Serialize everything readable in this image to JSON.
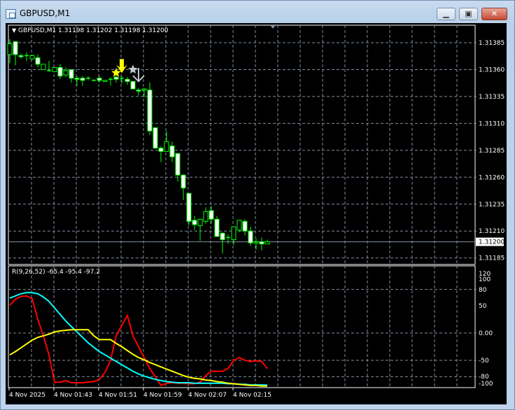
{
  "window": {
    "title": "GBPUSD,M1",
    "minimize_icon": "minimize-icon",
    "maximize_icon": "restore-icon",
    "close_icon": "close-icon"
  },
  "chart": {
    "header": "GBPUSD,M1  1.31198 1.31202 1.31198 1.31200",
    "symbol": "GBPUSD,M1",
    "current_price": "1.31200",
    "price_ticks": [
      "1.31385",
      "1.31360",
      "1.31335",
      "1.31310",
      "1.31285",
      "1.31260",
      "1.31235",
      "1.31210",
      "1.31185"
    ],
    "time_labels": [
      "4 Nov 2025",
      "4 Nov 01:43",
      "4 Nov 01:51",
      "4 Nov 01:59",
      "4 Nov 02:07",
      "4 Nov 02:15"
    ],
    "colors": {
      "background": "#000000",
      "bull": "#00ff00",
      "bear_fill": "#ffffff",
      "grid": "#8090a0",
      "bid_line": "#8090a0"
    },
    "candles_ohlc": [
      [
        1.31374,
        1.31388,
        1.31366,
        1.31384
      ],
      [
        1.31386,
        1.31386,
        1.31364,
        1.31374
      ],
      [
        1.31373,
        1.31375,
        1.3137,
        1.31372
      ],
      [
        1.31373,
        1.31376,
        1.31368,
        1.31373
      ],
      [
        1.3137,
        1.31374,
        1.31369,
        1.31373
      ],
      [
        1.31371,
        1.31374,
        1.31362,
        1.31365
      ],
      [
        1.3136,
        1.31365,
        1.3136,
        1.31365
      ],
      [
        1.31359,
        1.31368,
        1.31358,
        1.31359
      ],
      [
        1.31358,
        1.31362,
        1.31358,
        1.31362
      ],
      [
        1.31362,
        1.31365,
        1.31351,
        1.31354
      ],
      [
        1.31355,
        1.31362,
        1.31353,
        1.31359
      ],
      [
        1.3136,
        1.3136,
        1.31348,
        1.31352
      ],
      [
        1.31352,
        1.31354,
        1.31345,
        1.31351
      ],
      [
        1.31352,
        1.31354,
        1.31345,
        1.3135
      ],
      [
        1.31352,
        1.31354,
        1.3135,
        1.31352
      ],
      [
        1.3135,
        1.31351,
        1.31349,
        1.3135
      ],
      [
        1.31352,
        1.31354,
        1.31348,
        1.3135
      ],
      [
        1.31349,
        1.3135,
        1.31349,
        1.3135
      ],
      [
        1.31351,
        1.31353,
        1.31345,
        1.31351
      ],
      [
        1.31353,
        1.31354,
        1.31348,
        1.31351
      ],
      [
        1.31352,
        1.31354,
        1.31347,
        1.31352
      ],
      [
        1.31351,
        1.31353,
        1.31346,
        1.31349
      ],
      [
        1.31349,
        1.31349,
        1.31342,
        1.31342
      ],
      [
        1.31341,
        1.31343,
        1.31336,
        1.3134
      ],
      [
        1.31341,
        1.31343,
        1.31334,
        1.31342
      ],
      [
        1.31341,
        1.31348,
        1.31299,
        1.31303
      ],
      [
        1.31306,
        1.31306,
        1.31287,
        1.31287
      ],
      [
        1.31287,
        1.31289,
        1.31274,
        1.31284
      ],
      [
        1.31284,
        1.31303,
        1.31284,
        1.31293
      ],
      [
        1.31289,
        1.31293,
        1.31274,
        1.31279
      ],
      [
        1.31282,
        1.31282,
        1.31256,
        1.31262
      ],
      [
        1.31262,
        1.31263,
        1.31239,
        1.3125
      ],
      [
        1.31245,
        1.31245,
        1.31215,
        1.31219
      ],
      [
        1.3122,
        1.31224,
        1.31211,
        1.31216
      ],
      [
        1.31215,
        1.31221,
        1.31201,
        1.31221
      ],
      [
        1.31219,
        1.31232,
        1.31217,
        1.31228
      ],
      [
        1.31229,
        1.31233,
        1.31217,
        1.31221
      ],
      [
        1.31221,
        1.31224,
        1.31205,
        1.31205
      ],
      [
        1.31208,
        1.31209,
        1.31189,
        1.31202
      ],
      [
        1.31204,
        1.31207,
        1.31198,
        1.31204
      ],
      [
        1.31202,
        1.31214,
        1.31197,
        1.31214
      ],
      [
        1.31211,
        1.3122,
        1.31209,
        1.3122
      ],
      [
        1.31219,
        1.31221,
        1.31206,
        1.3121
      ],
      [
        1.3121,
        1.31214,
        1.31196,
        1.31199
      ],
      [
        1.31199,
        1.31203,
        1.31193,
        1.312
      ],
      [
        1.312,
        1.31204,
        1.31192,
        1.31198
      ],
      [
        1.31198,
        1.31202,
        1.31198,
        1.312
      ]
    ],
    "markers": [
      {
        "type": "star",
        "candle": 19,
        "price": 1.31357,
        "color": "#ffff00"
      },
      {
        "type": "arrow-down",
        "candle": 20,
        "price": 1.31362,
        "color": "#ffff00"
      },
      {
        "type": "star",
        "candle": 22,
        "price": 1.3136,
        "color": "#c0c8d0"
      },
      {
        "type": "arrow-down-outline",
        "candle": 23,
        "price": 1.31355,
        "color": "#c0c8d0"
      }
    ]
  },
  "indicator": {
    "label": "R(9,26,52) -65.4 -95.4 -97.2",
    "ticks": [
      "120",
      "100",
      "80",
      "50",
      "0.00",
      "-50",
      "-80",
      "-100"
    ],
    "tick_values": [
      120,
      100,
      80,
      50,
      0,
      -50,
      -80,
      -100
    ],
    "grid_levels": [
      80,
      0,
      -50,
      -80
    ],
    "series": [
      {
        "color": "#ff0000",
        "values": [
          51,
          62,
          67,
          68,
          63,
          25,
          -5,
          -40,
          -90,
          -90,
          -87,
          -91,
          -91,
          -91,
          -90,
          -89,
          -85,
          -72,
          -50,
          -5,
          14,
          32,
          -5,
          -25,
          -45,
          -65,
          -80,
          -96,
          -92,
          -91,
          -92,
          -92,
          -93,
          -93,
          -90,
          -78,
          -70,
          -70,
          -70,
          -65,
          -50,
          -45,
          -50,
          -52,
          -51,
          -52,
          -65.4
        ]
      },
      {
        "color": "#00ffff",
        "values": [
          64,
          68,
          72,
          74,
          74,
          72,
          66,
          58,
          46,
          34,
          22,
          12,
          2,
          -8,
          -18,
          -26,
          -34,
          -40,
          -46,
          -52,
          -58,
          -64,
          -70,
          -75,
          -79,
          -82,
          -85,
          -87,
          -89,
          -90,
          -91,
          -91,
          -91,
          -92,
          -92,
          -92,
          -92,
          -92,
          -92,
          -93,
          -93,
          -94,
          -94,
          -95,
          -95,
          -95,
          -95.4
        ]
      },
      {
        "color": "#ffff00",
        "values": [
          -40,
          -34,
          -27,
          -20,
          -13,
          -8,
          -5,
          -2,
          2,
          4,
          5,
          6,
          6,
          6,
          6,
          -5,
          -12,
          -12,
          -12,
          -19,
          -25,
          -32,
          -39,
          -45,
          -49,
          -54,
          -58,
          -62,
          -66,
          -70,
          -74,
          -78,
          -81,
          -83,
          -84,
          -86,
          -87,
          -89,
          -90,
          -92,
          -93,
          -94,
          -95,
          -96,
          -96,
          -97,
          -97.2
        ]
      }
    ]
  }
}
